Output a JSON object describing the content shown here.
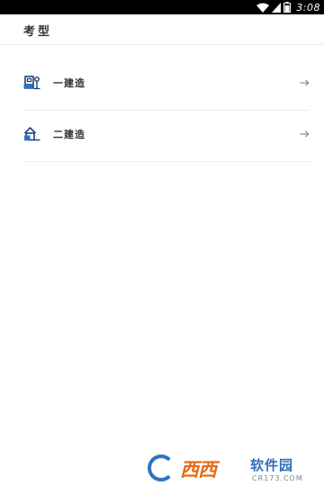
{
  "status_bar": {
    "time": "3:08",
    "icons": [
      "wifi-icon",
      "signal-icon",
      "battery-icon"
    ]
  },
  "header": {
    "title": "考型"
  },
  "exam_types": [
    {
      "label": "一建造",
      "icon": "building-icon"
    },
    {
      "label": "二建造",
      "icon": "house-icon"
    }
  ],
  "item_arrow": "→",
  "watermark": {
    "main": "西西",
    "sub": "软件园",
    "url": "CR173.COM"
  },
  "colors": {
    "status_bar": "#000000",
    "text": "#333333",
    "divider": "#ececec",
    "icon": "#1f3f73",
    "arrow": "#6b7c9a"
  }
}
